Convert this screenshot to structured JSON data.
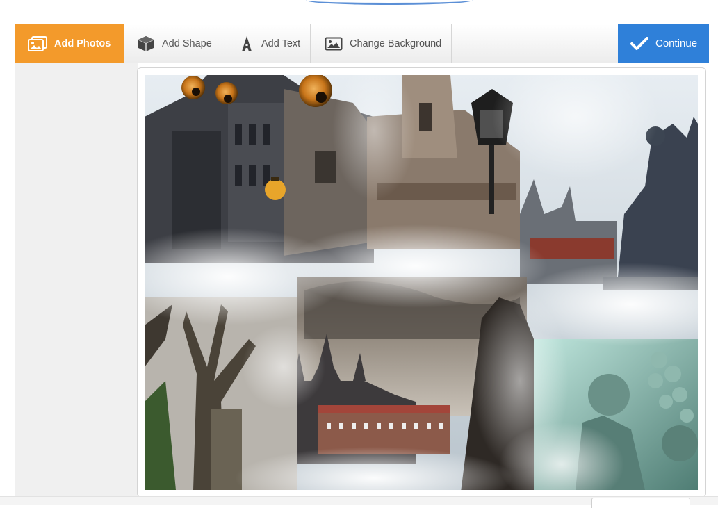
{
  "toolbar": {
    "add_photos": "Add Photos",
    "add_shape": "Add Shape",
    "add_text": "Add Text",
    "change_background": "Change Background",
    "continue": "Continue"
  },
  "colors": {
    "accent_orange": "#f39a2b",
    "accent_blue": "#2f80d9"
  },
  "icons": [
    "photos-icon",
    "cube-icon",
    "text-a-icon",
    "image-icon",
    "checkmark-icon"
  ]
}
